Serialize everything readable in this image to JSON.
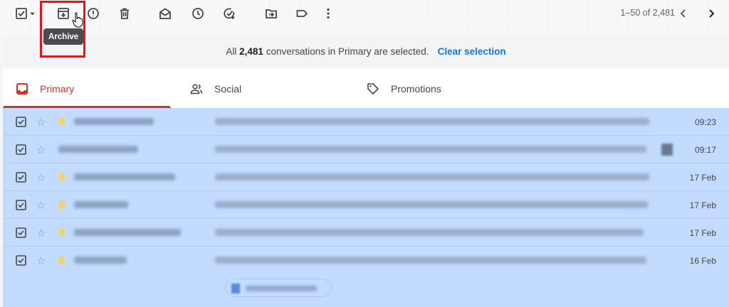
{
  "toolbar": {
    "tooltip": "Archive",
    "icons": [
      "select-all-checkbox-icon",
      "select-dropdown-icon",
      "archive-icon",
      "report-spam-icon",
      "delete-icon",
      "mark-as-read-icon",
      "snooze-icon",
      "add-to-tasks-icon",
      "move-to-icon",
      "label-icon",
      "more-icon"
    ],
    "pager": "1–50 of 2,481"
  },
  "banner": {
    "prefix": "All",
    "count": "2,481",
    "suffix": "conversations in Primary are selected.",
    "clear": "Clear selection"
  },
  "tabs": [
    {
      "label": "Primary",
      "icon": "inbox-icon",
      "active": true
    },
    {
      "label": "Social",
      "icon": "people-icon",
      "active": false
    },
    {
      "label": "Promotions",
      "icon": "tag-icon",
      "active": false
    }
  ],
  "emails": [
    {
      "date": "09:23",
      "selected": true,
      "important": true
    },
    {
      "date": "09:17",
      "selected": true,
      "important": false
    },
    {
      "date": "17 Feb",
      "selected": true,
      "important": true
    },
    {
      "date": "17 Feb",
      "selected": true,
      "important": true
    },
    {
      "date": "17 Feb",
      "selected": true,
      "important": true
    },
    {
      "date": "16 Feb",
      "selected": true,
      "important": true
    }
  ],
  "colors": {
    "selection": "#c2dbff",
    "accent": "#d93025",
    "link": "#1a73e8",
    "highlight": "#e8141c"
  }
}
